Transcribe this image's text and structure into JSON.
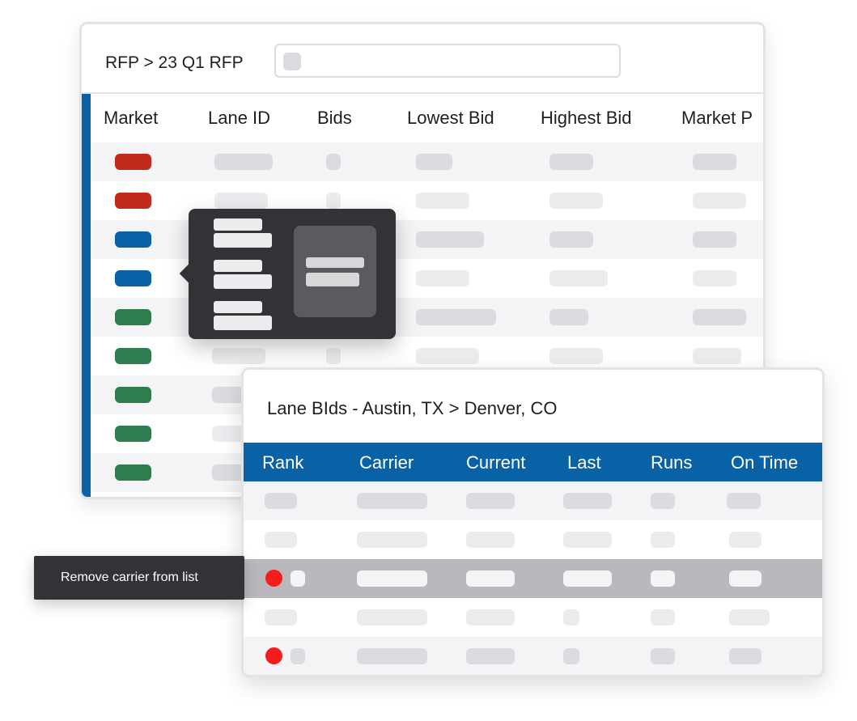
{
  "rfp": {
    "breadcrumb": "RFP > 23 Q1 RFP",
    "search_icon": "search-icon",
    "columns": [
      "Market",
      "Lane ID",
      "Bids",
      "Lowest Bid",
      "Highest Bid",
      "Market P"
    ],
    "market_colors": [
      "#c22a1a",
      "#c22a1a",
      "#0a62a6",
      "#0a62a6",
      "#2f7d4e",
      "#2f7d4e",
      "#2f7d4e",
      "#2f7d4e",
      "#2f7d4e"
    ]
  },
  "lane_bids": {
    "title": "Lane BIds - Austin, TX > Denver, CO",
    "columns": [
      "Rank",
      "Carrier",
      "Current",
      "Last",
      "Runs",
      "On Time"
    ],
    "header_color": "#0a62a6",
    "remove_indicator_color": "#f41c1c"
  },
  "tooltip": {
    "text": "Remove carrier from list"
  }
}
